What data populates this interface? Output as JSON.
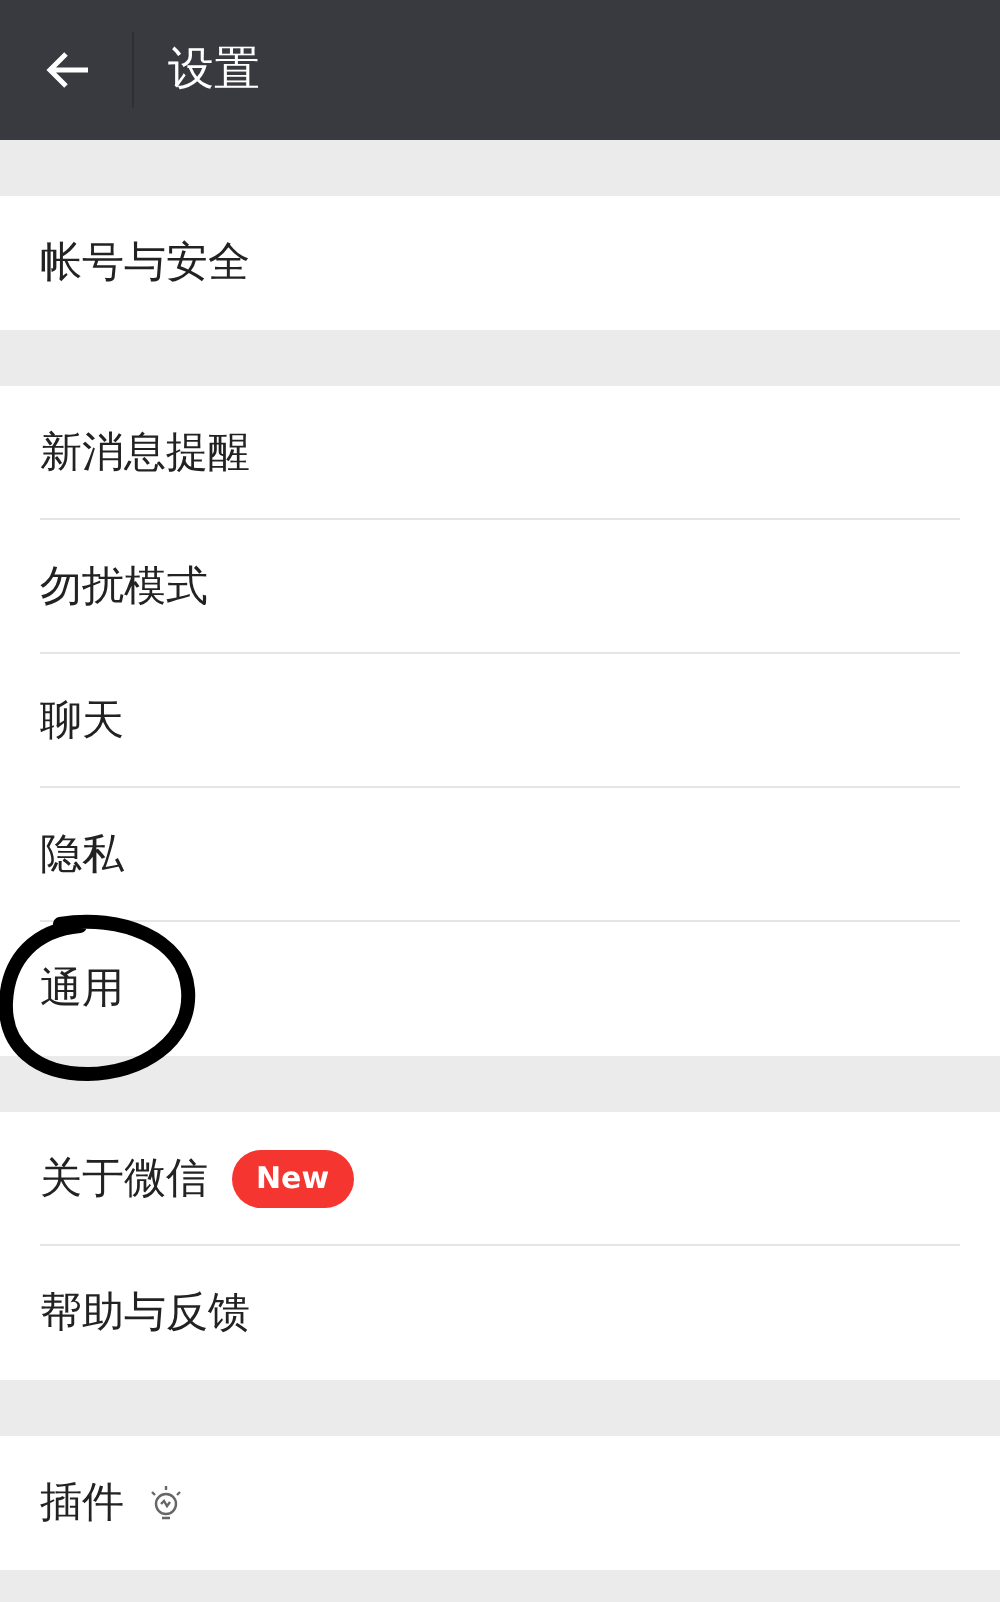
{
  "header": {
    "title": "设置"
  },
  "groups": [
    {
      "items": [
        {
          "label": "帐号与安全",
          "kind": "plain",
          "circled": false
        }
      ]
    },
    {
      "items": [
        {
          "label": "新消息提醒",
          "kind": "plain",
          "circled": false
        },
        {
          "label": "勿扰模式",
          "kind": "plain",
          "circled": false
        },
        {
          "label": "聊天",
          "kind": "plain",
          "circled": false
        },
        {
          "label": "隐私",
          "kind": "plain",
          "circled": false
        },
        {
          "label": "通用",
          "kind": "plain",
          "circled": true
        }
      ]
    },
    {
      "items": [
        {
          "label": "关于微信",
          "kind": "badge",
          "badge": "New",
          "circled": false
        },
        {
          "label": "帮助与反馈",
          "kind": "plain",
          "circled": false
        }
      ]
    },
    {
      "items": [
        {
          "label": "插件",
          "kind": "icon",
          "circled": false
        }
      ]
    }
  ]
}
